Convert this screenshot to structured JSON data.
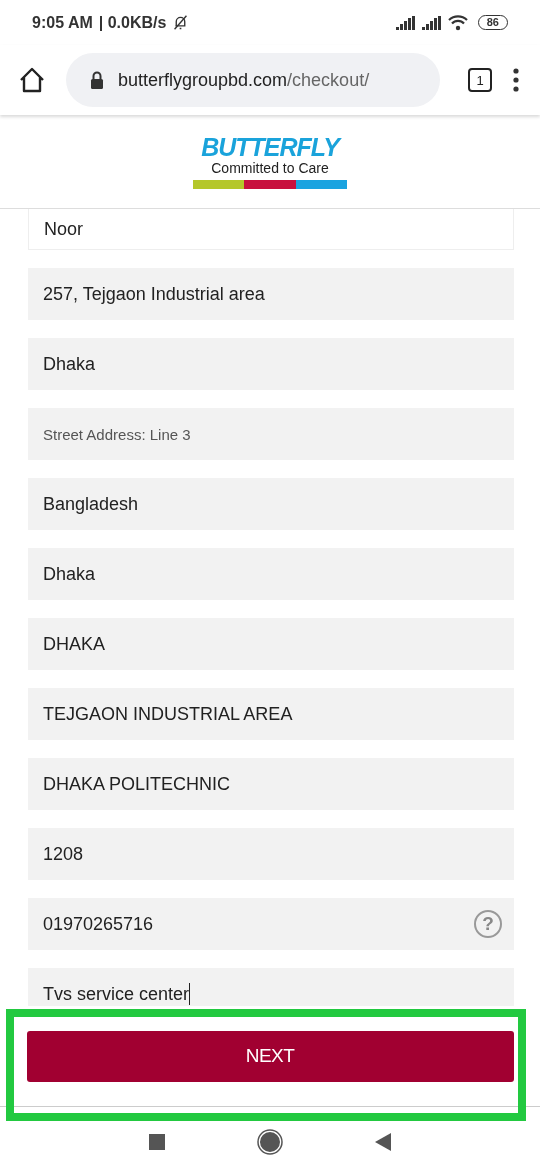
{
  "status_bar": {
    "time": "9:05 AM",
    "speed": "| 0.0KB/s",
    "battery": "86"
  },
  "browser": {
    "url_host": "butterflygroupbd.com",
    "url_path": "/checkout/",
    "tab_count": "1"
  },
  "logo": {
    "brand": "BUTTERFLY",
    "tagline": "Committed to Care"
  },
  "fields": [
    {
      "kind": "value",
      "text": "Noor",
      "cut": true,
      "help": false,
      "focused": false
    },
    {
      "kind": "value",
      "text": "257, Tejgaon Industrial area",
      "cut": false,
      "help": false,
      "focused": false
    },
    {
      "kind": "value",
      "text": "Dhaka",
      "cut": false,
      "help": false,
      "focused": false
    },
    {
      "kind": "placeholder",
      "text": "Street Address: Line 3",
      "cut": false,
      "help": false,
      "focused": false
    },
    {
      "kind": "value",
      "text": "Bangladesh",
      "cut": false,
      "help": false,
      "focused": false
    },
    {
      "kind": "value",
      "text": "Dhaka",
      "cut": false,
      "help": false,
      "focused": false
    },
    {
      "kind": "value",
      "text": "DHAKA",
      "cut": false,
      "help": false,
      "focused": false
    },
    {
      "kind": "value",
      "text": "TEJGAON INDUSTRIAL AREA",
      "cut": false,
      "help": false,
      "focused": false
    },
    {
      "kind": "value",
      "text": "DHAKA POLITECHNIC",
      "cut": false,
      "help": false,
      "focused": false
    },
    {
      "kind": "value",
      "text": "1208",
      "cut": false,
      "help": false,
      "focused": false
    },
    {
      "kind": "value",
      "text": "01970265716",
      "cut": false,
      "help": "?",
      "focused": false
    },
    {
      "kind": "value",
      "text": "Tvs service center",
      "cut": false,
      "help": false,
      "focused": true
    }
  ],
  "footer": {
    "button": "NEXT",
    "highlighted": true
  }
}
